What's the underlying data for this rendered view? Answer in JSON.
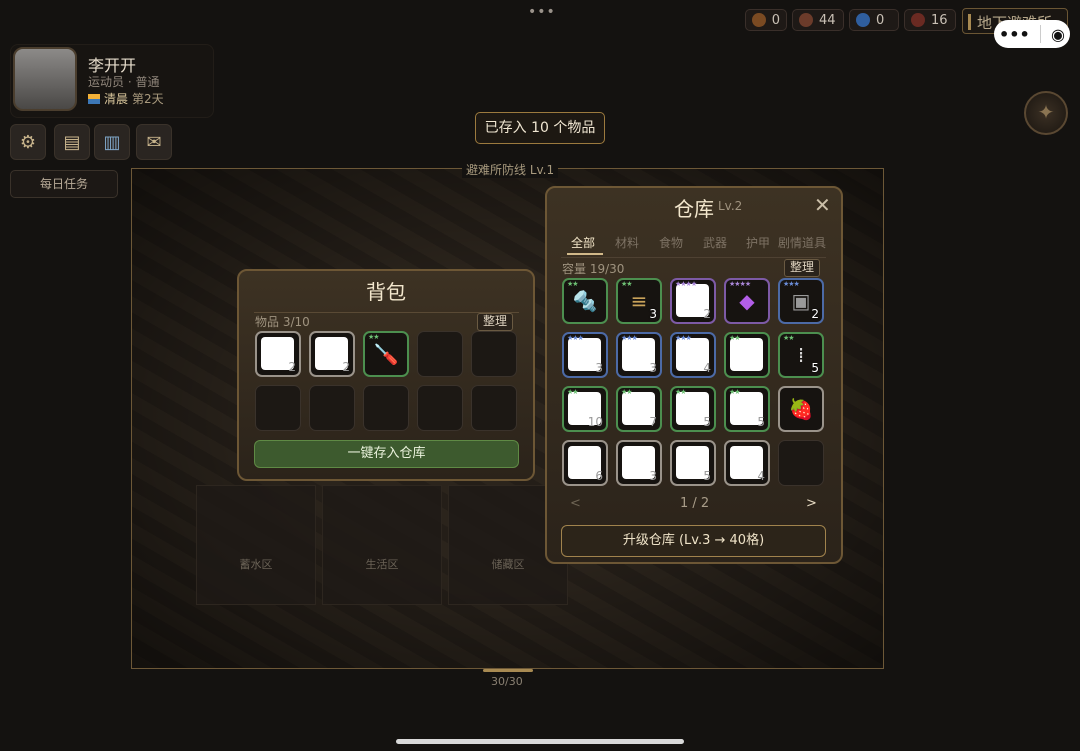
{
  "top_dots": "•••",
  "resources": [
    {
      "icon": "bolt-icon",
      "value": "0",
      "color": "#7a4a22"
    },
    {
      "icon": "meat-icon",
      "value": "44",
      "color": "#6b3b2a"
    },
    {
      "icon": "water-icon",
      "value": "0",
      "color": "#2f5e9e"
    },
    {
      "icon": "heart-icon",
      "value": "16",
      "color": "#6a2a22"
    }
  ],
  "location": "地下避难所",
  "profile": {
    "name": "李开开",
    "role": "运动员 · 普通",
    "time_of_day": "清晨",
    "day": "第2天"
  },
  "toolbar": {
    "settings_icon": "gear-icon",
    "notes_icon": "notebook-icon",
    "book_icon": "book-icon",
    "mail_icon": "mail-icon"
  },
  "daily_tasks": "每日任务",
  "toast": "已存入 10 个物品",
  "map": {
    "title": "避难所防线 Lv.1",
    "rooms": [
      "蓄水区",
      "生活区",
      "储藏区"
    ],
    "counter": "30/30"
  },
  "backpack": {
    "title": "背包",
    "count_label": "物品 3/10",
    "sort_label": "整理",
    "slots": [
      {
        "type": "card",
        "count": "2"
      },
      {
        "type": "card",
        "count": "2"
      },
      {
        "type": "item",
        "icon": "screwdriver-icon",
        "stars": "★★",
        "rarity": "g"
      },
      {
        "type": "empty"
      },
      {
        "type": "empty"
      },
      {
        "type": "empty"
      },
      {
        "type": "empty"
      },
      {
        "type": "empty"
      },
      {
        "type": "empty"
      },
      {
        "type": "empty"
      }
    ],
    "store_all_label": "一键存入仓库"
  },
  "warehouse": {
    "title": "仓库",
    "level": "Lv.2",
    "close_icon": "close-icon",
    "tabs": [
      "全部",
      "材料",
      "食物",
      "武器",
      "护甲",
      "剧情道具"
    ],
    "capacity_label": "容量 19/30",
    "sort_label": "整理",
    "slots": [
      {
        "type": "item",
        "icon": "drill-icon",
        "stars": "★★",
        "rarity": "g"
      },
      {
        "type": "item",
        "icon": "ammo-icon",
        "stars": "★★",
        "rarity": "g",
        "count": "3"
      },
      {
        "type": "card",
        "stars": "★★★★",
        "rarity": "p",
        "count": "2"
      },
      {
        "type": "item",
        "icon": "gem-icon",
        "stars": "★★★★",
        "rarity": "p"
      },
      {
        "type": "item",
        "icon": "chest-icon",
        "stars": "★★★",
        "rarity": "b",
        "count": "2"
      },
      {
        "type": "card",
        "stars": "★★★",
        "rarity": "b",
        "count": "3"
      },
      {
        "type": "card",
        "stars": "★★★",
        "rarity": "b",
        "count": "3"
      },
      {
        "type": "card",
        "stars": "★★★",
        "rarity": "b",
        "count": "4"
      },
      {
        "type": "card",
        "stars": "★★",
        "rarity": "g"
      },
      {
        "type": "item",
        "icon": "pills-icon",
        "stars": "★★",
        "rarity": "g",
        "count": "5"
      },
      {
        "type": "card",
        "stars": "★★",
        "rarity": "g",
        "count": "10"
      },
      {
        "type": "card",
        "stars": "★★",
        "rarity": "g",
        "count": "7"
      },
      {
        "type": "card",
        "stars": "★★",
        "rarity": "g",
        "count": "5"
      },
      {
        "type": "card",
        "stars": "★★",
        "rarity": "g",
        "count": "5"
      },
      {
        "type": "item",
        "icon": "strawberry-icon"
      },
      {
        "type": "card",
        "count": "6"
      },
      {
        "type": "card",
        "count": "3"
      },
      {
        "type": "card",
        "count": "5"
      },
      {
        "type": "card",
        "count": "4"
      },
      {
        "type": "empty"
      }
    ],
    "prev_label": "<",
    "page": "1 / 2",
    "next_label": ">",
    "upgrade_label": "升级仓库 (Lv.3 → 40格)"
  }
}
